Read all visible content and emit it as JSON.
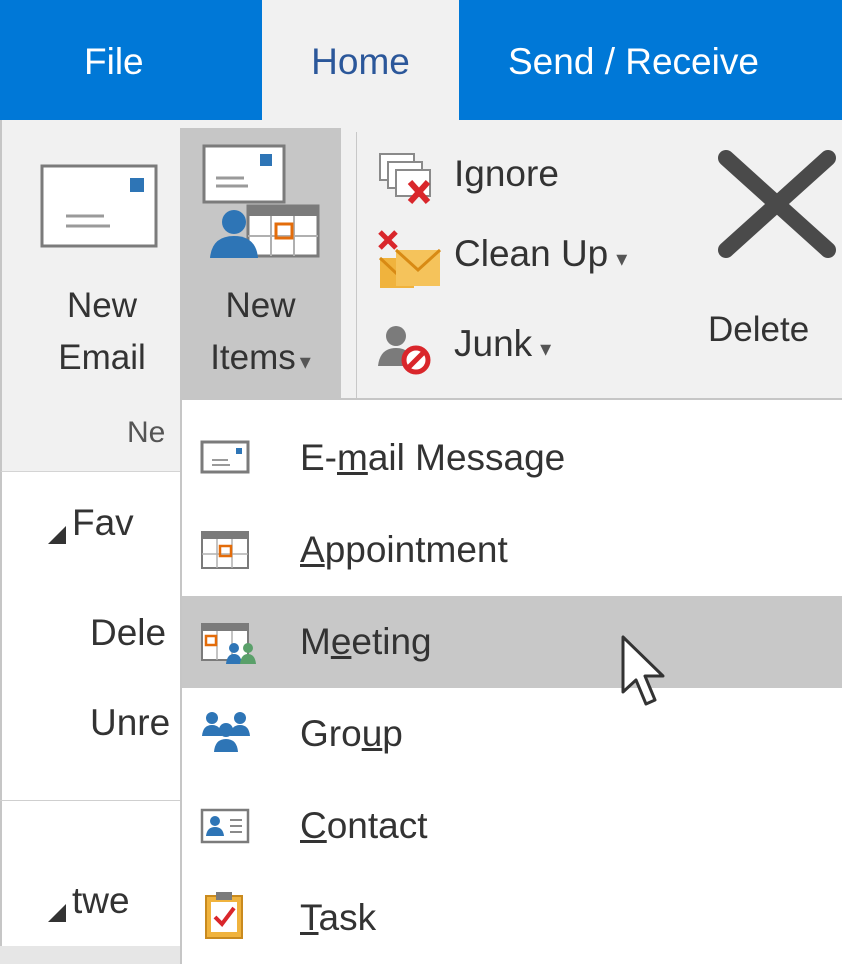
{
  "tabs": [
    {
      "label": "File"
    },
    {
      "label": "Home",
      "selected": true
    },
    {
      "label": "Send / Receive"
    }
  ],
  "ribbon": {
    "new_email": {
      "line1": "New",
      "line2": "Email"
    },
    "new_items": {
      "line1": "New",
      "line2": "Items",
      "dropdown_glyph": "▾"
    },
    "group_label": "Ne",
    "ignore": "Ignore",
    "clean_up": "Clean Up",
    "junk": "Junk",
    "dropdown_glyph": "▾",
    "delete": "Delete"
  },
  "left_pane": {
    "favorites": "Fav",
    "deleted": "Dele",
    "unread": "Unre",
    "account": "twe"
  },
  "menu": {
    "items": [
      {
        "pre": "E-",
        "ul": "m",
        "post": "ail Message",
        "icon": "email-icon"
      },
      {
        "pre": "",
        "ul": "A",
        "post": "ppointment",
        "icon": "calendar-icon"
      },
      {
        "pre": "M",
        "ul": "e",
        "post": "eting",
        "icon": "meeting-icon",
        "highlighted": true
      },
      {
        "pre": "Gro",
        "ul": "u",
        "post": "p",
        "icon": "group-icon"
      },
      {
        "pre": "",
        "ul": "C",
        "post": "ontact",
        "icon": "contact-card-icon"
      },
      {
        "pre": "",
        "ul": "T",
        "post": "ask",
        "icon": "task-clipboard-icon"
      }
    ]
  },
  "colors": {
    "accent": "#0078d7",
    "ribbon_bg": "#f1f1f1",
    "highlight": "#c8c8c8"
  }
}
